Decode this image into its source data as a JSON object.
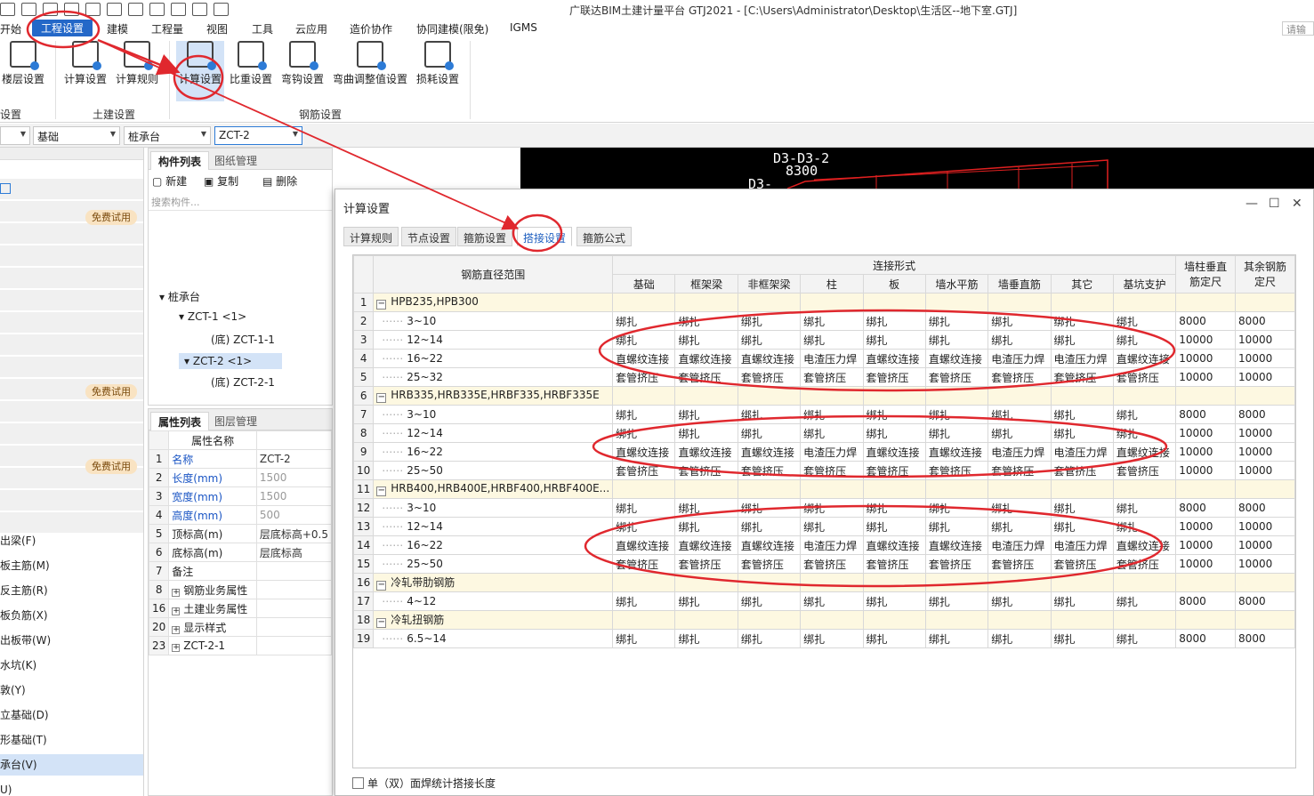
{
  "app": {
    "title": "广联达BIM土建计量平台 GTJ2021 - [C:\\Users\\Administrator\\Desktop\\生活区--地下室.GTJ]",
    "login": "请输"
  },
  "menu": [
    {
      "label": "开始",
      "active": false
    },
    {
      "label": "工程设置",
      "active": true
    },
    {
      "label": "建模",
      "active": false
    },
    {
      "label": "工程量",
      "active": false
    },
    {
      "label": "视图",
      "active": false
    },
    {
      "label": "工具",
      "active": false
    },
    {
      "label": "云应用",
      "active": false
    },
    {
      "label": "造价协作",
      "active": false
    },
    {
      "label": "协同建模(限免)",
      "active": false
    },
    {
      "label": "IGMS",
      "active": false
    }
  ],
  "ribbon": {
    "buttons": [
      "楼层设置",
      "计算设置",
      "计算规则",
      "计算设置",
      "比重设置",
      "弯钩设置",
      "弯曲调整值设置",
      "损耗设置"
    ],
    "groups": [
      "设置",
      "土建设置",
      "钢筋设置"
    ]
  },
  "selectors": [
    {
      "value": "",
      "icon": "dropdown-arrow"
    },
    {
      "value": "基础",
      "icon": "dropdown-arrow"
    },
    {
      "value": "桩承台",
      "icon": "dropdown-arrow"
    },
    {
      "value": "ZCT-2",
      "icon": "dropdown-arrow"
    }
  ],
  "leftnav": {
    "trial_label": "免费试用",
    "items": [
      "出梁(F)",
      "板主筋(M)",
      "反主筋(R)",
      "板负筋(X)",
      "出板带(W)",
      "水坑(K)",
      "敦(Y)",
      "立基础(D)",
      "形基础(T)",
      "承台(V)",
      "U)"
    ],
    "selected_index": 9
  },
  "component_panel": {
    "tabs": [
      "构件列表",
      "图纸管理"
    ],
    "tools": [
      "新建",
      "复制",
      "删除"
    ],
    "search_placeholder": "搜索构件...",
    "tree": [
      "桩承台",
      "ZCT-1 <1>",
      "(底) ZCT-1-1",
      "ZCT-2 <1>",
      "(底) ZCT-2-1"
    ]
  },
  "property_panel": {
    "tabs": [
      "属性列表",
      "图层管理"
    ],
    "header": "属性名称",
    "rows": [
      {
        "num": "1",
        "name": "名称",
        "value": "ZCT-2",
        "blue": true,
        "grey": false,
        "expand": false
      },
      {
        "num": "2",
        "name": "长度(mm)",
        "value": "1500",
        "blue": true,
        "grey": true,
        "expand": false
      },
      {
        "num": "3",
        "name": "宽度(mm)",
        "value": "1500",
        "blue": true,
        "grey": true,
        "expand": false
      },
      {
        "num": "4",
        "name": "高度(mm)",
        "value": "500",
        "blue": true,
        "grey": true,
        "expand": false
      },
      {
        "num": "5",
        "name": "顶标高(m)",
        "value": "层底标高+0.5",
        "blue": false,
        "grey": false,
        "expand": false
      },
      {
        "num": "6",
        "name": "底标高(m)",
        "value": "层底标高",
        "blue": false,
        "grey": false,
        "expand": false
      },
      {
        "num": "7",
        "name": "备注",
        "value": "",
        "blue": false,
        "grey": false,
        "expand": false
      },
      {
        "num": "8",
        "name": "钢筋业务属性",
        "value": "",
        "blue": false,
        "grey": false,
        "expand": true
      },
      {
        "num": "16",
        "name": "土建业务属性",
        "value": "",
        "blue": false,
        "grey": false,
        "expand": true
      },
      {
        "num": "20",
        "name": "显示样式",
        "value": "",
        "blue": false,
        "grey": false,
        "expand": true
      },
      {
        "num": "23",
        "name": "ZCT-2-1",
        "value": "",
        "blue": false,
        "grey": false,
        "expand": true
      }
    ]
  },
  "canvas": {
    "labels": [
      "D3-D3-2",
      "8300",
      "D3-"
    ]
  },
  "dialog": {
    "title": "计算设置",
    "tabs": [
      "计算规则",
      "节点设置",
      "箍筋设置",
      "搭接设置",
      "箍筋公式"
    ],
    "active_tab": 3,
    "table": {
      "range_header": "钢筋直径范围",
      "conn_header": "连接形式",
      "conn_cols": [
        "基础",
        "框架梁",
        "非框架梁",
        "柱",
        "板",
        "墙水平筋",
        "墙垂直筋",
        "其它",
        "基坑支护"
      ],
      "extra_cols": [
        "墙柱垂直筋定尺",
        "其余钢筋定尺"
      ],
      "rows": [
        {
          "n": "1",
          "group": true,
          "label": "HPB235,HPB300",
          "cells": []
        },
        {
          "n": "2",
          "group": false,
          "label": "3~10",
          "cells": [
            "绑扎",
            "绑扎",
            "绑扎",
            "绑扎",
            "绑扎",
            "绑扎",
            "绑扎",
            "绑扎",
            "绑扎",
            "8000",
            "8000"
          ]
        },
        {
          "n": "3",
          "group": false,
          "label": "12~14",
          "cells": [
            "绑扎",
            "绑扎",
            "绑扎",
            "绑扎",
            "绑扎",
            "绑扎",
            "绑扎",
            "绑扎",
            "绑扎",
            "10000",
            "10000"
          ]
        },
        {
          "n": "4",
          "group": false,
          "label": "16~22",
          "cells": [
            "直螺纹连接",
            "直螺纹连接",
            "直螺纹连接",
            "电渣压力焊",
            "直螺纹连接",
            "直螺纹连接",
            "电渣压力焊",
            "电渣压力焊",
            "直螺纹连接",
            "10000",
            "10000"
          ]
        },
        {
          "n": "5",
          "group": false,
          "label": "25~32",
          "cells": [
            "套管挤压",
            "套管挤压",
            "套管挤压",
            "套管挤压",
            "套管挤压",
            "套管挤压",
            "套管挤压",
            "套管挤压",
            "套管挤压",
            "10000",
            "10000"
          ]
        },
        {
          "n": "6",
          "group": true,
          "label": "HRB335,HRB335E,HRBF335,HRBF335E",
          "cells": []
        },
        {
          "n": "7",
          "group": false,
          "label": "3~10",
          "cells": [
            "绑扎",
            "绑扎",
            "绑扎",
            "绑扎",
            "绑扎",
            "绑扎",
            "绑扎",
            "绑扎",
            "绑扎",
            "8000",
            "8000"
          ]
        },
        {
          "n": "8",
          "group": false,
          "label": "12~14",
          "cells": [
            "绑扎",
            "绑扎",
            "绑扎",
            "绑扎",
            "绑扎",
            "绑扎",
            "绑扎",
            "绑扎",
            "绑扎",
            "10000",
            "10000"
          ]
        },
        {
          "n": "9",
          "group": false,
          "label": "16~22",
          "cells": [
            "直螺纹连接",
            "直螺纹连接",
            "直螺纹连接",
            "电渣压力焊",
            "直螺纹连接",
            "直螺纹连接",
            "电渣压力焊",
            "电渣压力焊",
            "直螺纹连接",
            "10000",
            "10000"
          ]
        },
        {
          "n": "10",
          "group": false,
          "label": "25~50",
          "cells": [
            "套管挤压",
            "套管挤压",
            "套管挤压",
            "套管挤压",
            "套管挤压",
            "套管挤压",
            "套管挤压",
            "套管挤压",
            "套管挤压",
            "10000",
            "10000"
          ]
        },
        {
          "n": "11",
          "group": true,
          "label": "HRB400,HRB400E,HRBF400,HRBF400E...",
          "cells": []
        },
        {
          "n": "12",
          "group": false,
          "label": "3~10",
          "cells": [
            "绑扎",
            "绑扎",
            "绑扎",
            "绑扎",
            "绑扎",
            "绑扎",
            "绑扎",
            "绑扎",
            "绑扎",
            "8000",
            "8000"
          ]
        },
        {
          "n": "13",
          "group": false,
          "label": "12~14",
          "cells": [
            "绑扎",
            "绑扎",
            "绑扎",
            "绑扎",
            "绑扎",
            "绑扎",
            "绑扎",
            "绑扎",
            "绑扎",
            "10000",
            "10000"
          ]
        },
        {
          "n": "14",
          "group": false,
          "label": "16~22",
          "cells": [
            "直螺纹连接",
            "直螺纹连接",
            "直螺纹连接",
            "电渣压力焊",
            "直螺纹连接",
            "直螺纹连接",
            "电渣压力焊",
            "电渣压力焊",
            "直螺纹连接",
            "10000",
            "10000"
          ]
        },
        {
          "n": "15",
          "group": false,
          "label": "25~50",
          "cells": [
            "套管挤压",
            "套管挤压",
            "套管挤压",
            "套管挤压",
            "套管挤压",
            "套管挤压",
            "套管挤压",
            "套管挤压",
            "套管挤压",
            "10000",
            "10000"
          ]
        },
        {
          "n": "16",
          "group": true,
          "label": "冷轧带肋钢筋",
          "cells": []
        },
        {
          "n": "17",
          "group": false,
          "label": "4~12",
          "cells": [
            "绑扎",
            "绑扎",
            "绑扎",
            "绑扎",
            "绑扎",
            "绑扎",
            "绑扎",
            "绑扎",
            "绑扎",
            "8000",
            "8000"
          ]
        },
        {
          "n": "18",
          "group": true,
          "label": "冷轧扭钢筋",
          "cells": []
        },
        {
          "n": "19",
          "group": false,
          "label": "6.5~14",
          "cells": [
            "绑扎",
            "绑扎",
            "绑扎",
            "绑扎",
            "绑扎",
            "绑扎",
            "绑扎",
            "绑扎",
            "绑扎",
            "8000",
            "8000"
          ]
        }
      ]
    },
    "checkbox_label": "单（双）面焊统计搭接长度"
  },
  "colors": {
    "accent": "#2468c8",
    "annotation": "#e0282e",
    "group_row": "#fdf8e1"
  }
}
